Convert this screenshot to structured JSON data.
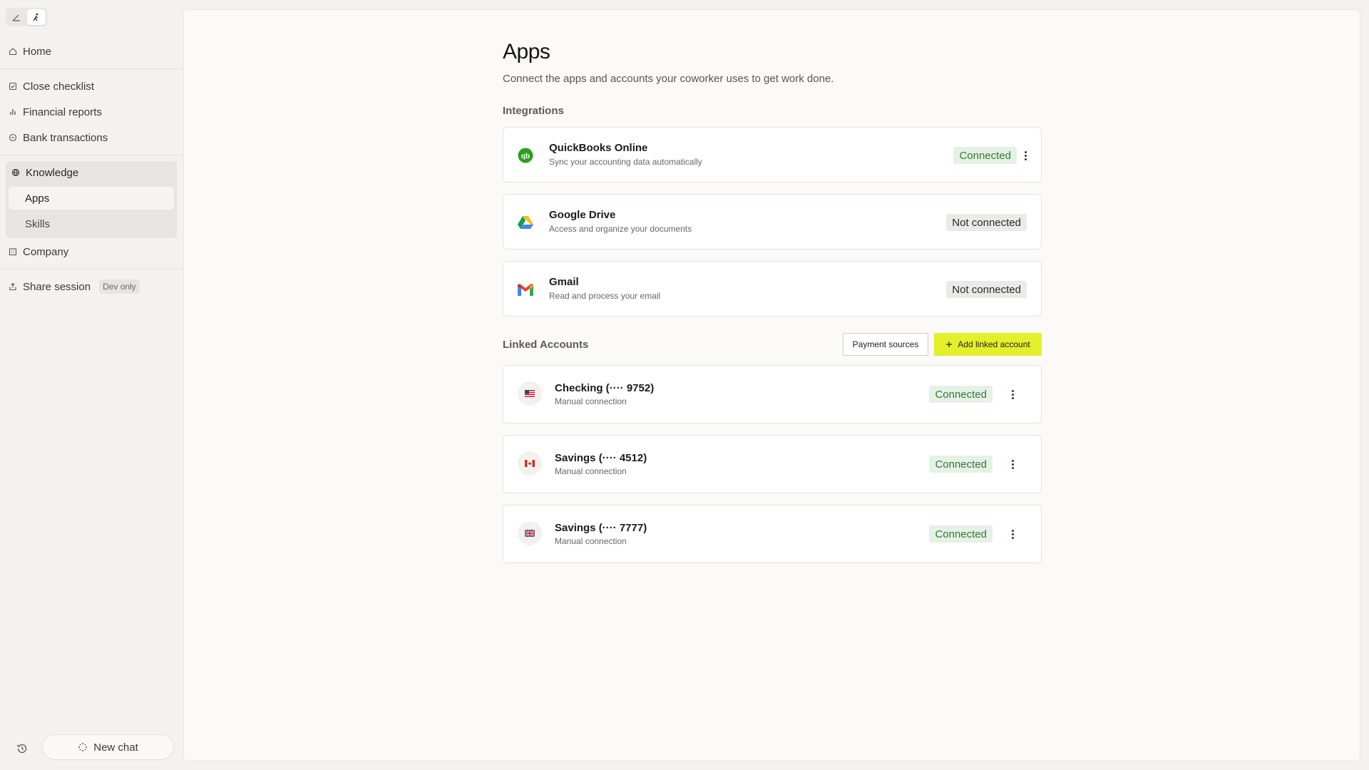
{
  "sidebar": {
    "nav": {
      "home": "Home",
      "close_checklist": "Close checklist",
      "financial_reports": "Financial reports",
      "bank_transactions": "Bank transactions",
      "knowledge": "Knowledge",
      "apps": "Apps",
      "skills": "Skills",
      "company": "Company",
      "share_session": "Share session",
      "dev_only": "Dev only"
    },
    "new_chat": "New chat"
  },
  "page": {
    "title": "Apps",
    "subtitle": "Connect the apps and accounts your coworker uses to get work done."
  },
  "integrations": {
    "label": "Integrations",
    "items": [
      {
        "name": "QuickBooks Online",
        "desc": "Sync your accounting data automatically",
        "status": "Connected",
        "icon": "quickbooks-icon"
      },
      {
        "name": "Google Drive",
        "desc": "Access and organize your documents",
        "status": "Not connected",
        "icon": "google-drive-icon"
      },
      {
        "name": "Gmail",
        "desc": "Read and process your email",
        "status": "Not connected",
        "icon": "gmail-icon"
      }
    ]
  },
  "linked_accounts": {
    "label": "Linked Accounts",
    "payment_sources": "Payment sources",
    "add_linked_account": "Add linked account",
    "items": [
      {
        "name": "Checking (···· 9752)",
        "desc": "Manual connection",
        "status": "Connected",
        "icon": "us-flag-icon"
      },
      {
        "name": "Savings (···· 4512)",
        "desc": "Manual connection",
        "status": "Connected",
        "icon": "canada-flag-icon"
      },
      {
        "name": "Savings (···· 7777)",
        "desc": "Manual connection",
        "status": "Connected",
        "icon": "uk-flag-icon"
      }
    ]
  },
  "colors": {
    "accent": "#e3ef2b",
    "connected_bg": "#e6f1e6",
    "connected_text": "#2f7a35",
    "not_connected_bg": "#ebeae7"
  }
}
